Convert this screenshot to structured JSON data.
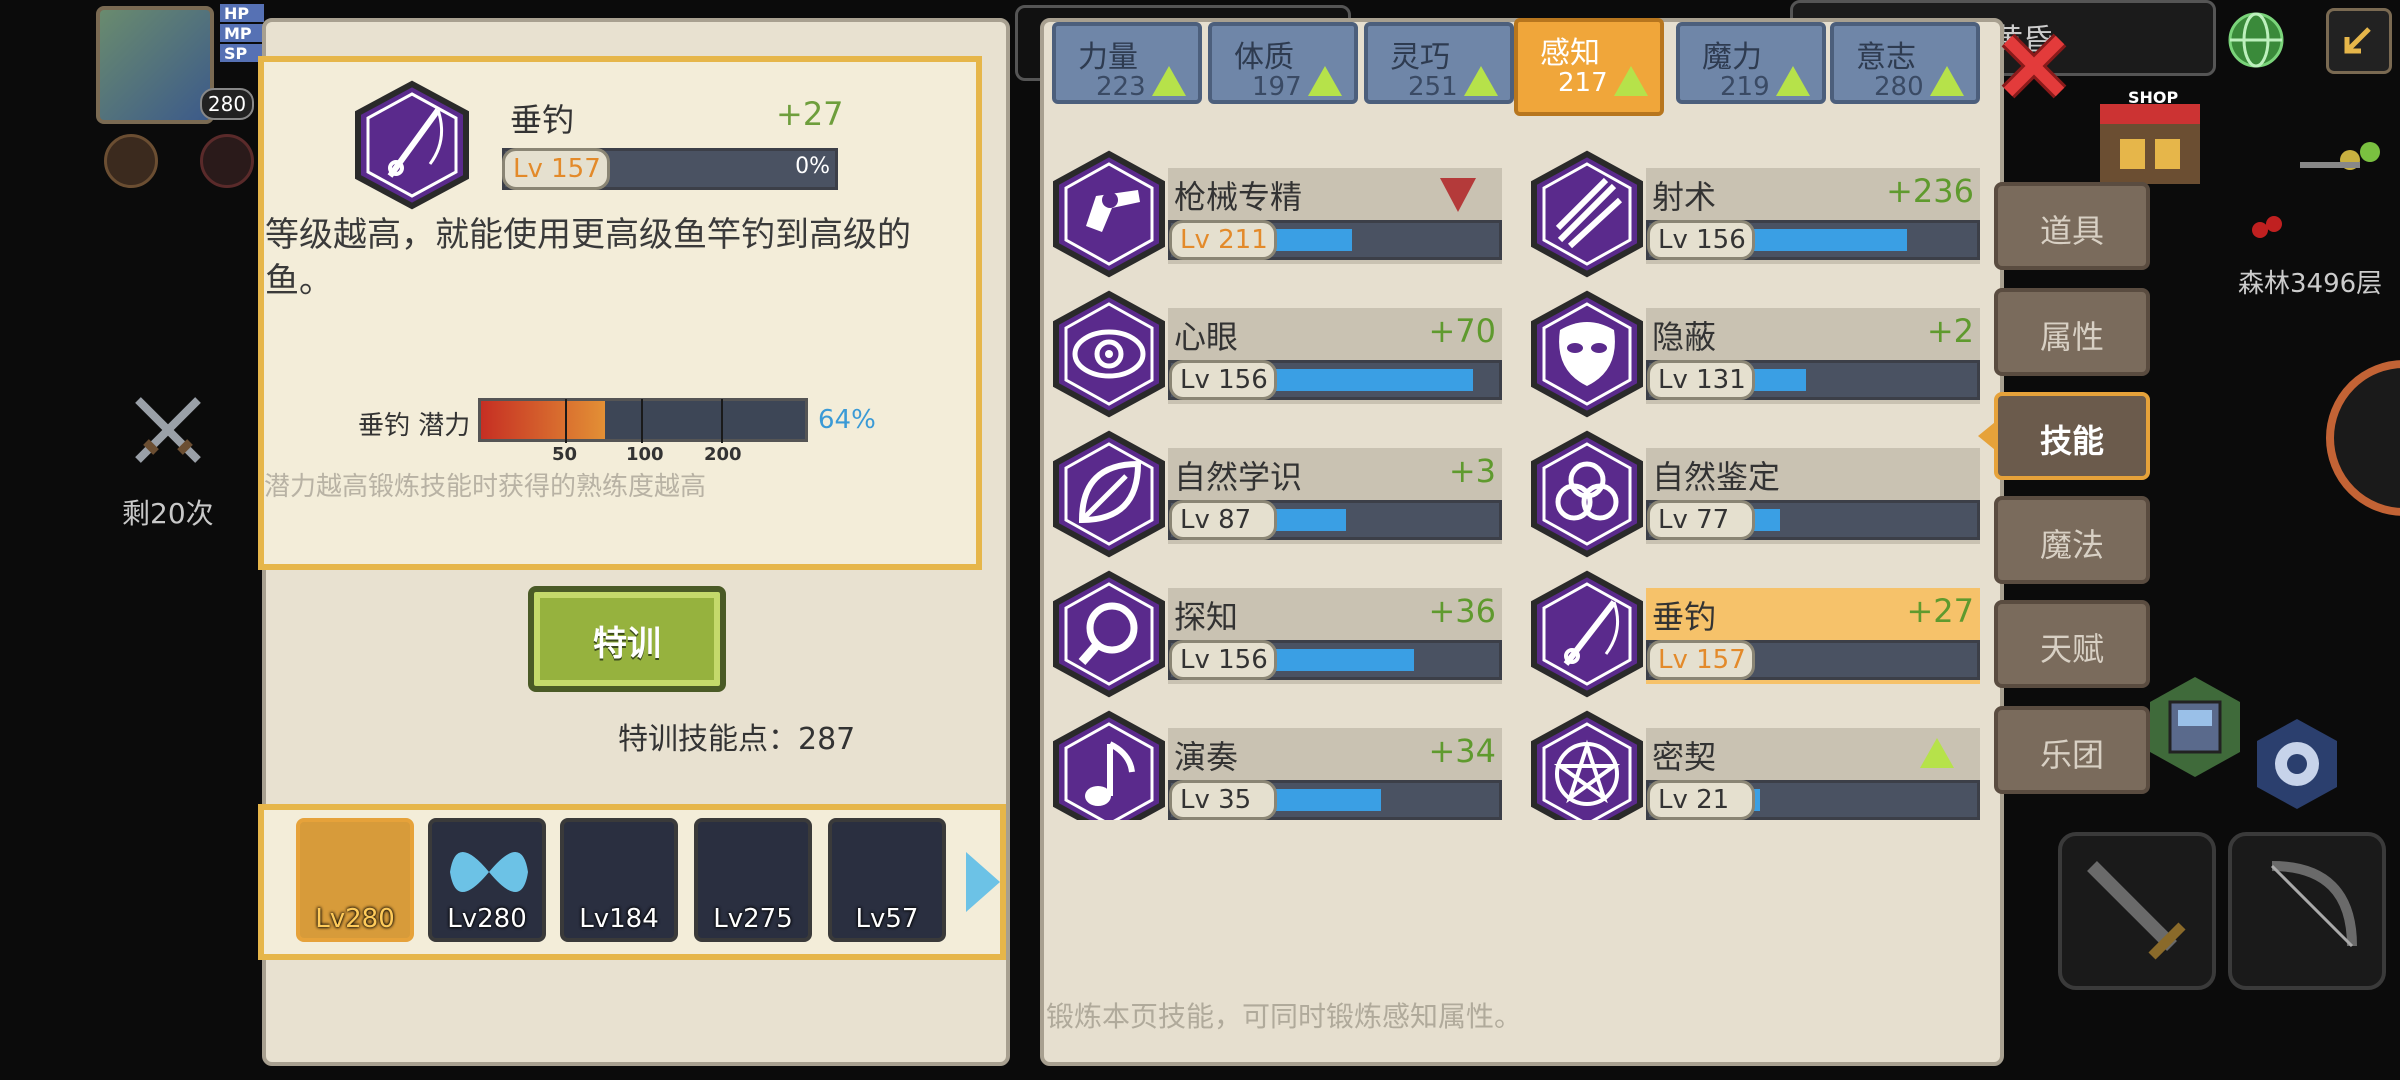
{
  "hud": {
    "hp_label": "HP",
    "mp_label": "MP",
    "sp_label": "SP",
    "player_level": "280",
    "attack_count": "剩20次",
    "floor": "森林3496层",
    "shop_label": "SHOP",
    "location_partial": "黄昏"
  },
  "stat_tabs": [
    {
      "name": "力量",
      "value": "223"
    },
    {
      "name": "体质",
      "value": "197"
    },
    {
      "name": "灵巧",
      "value": "251"
    },
    {
      "name": "感知",
      "value": "217"
    },
    {
      "name": "魔力",
      "value": "219"
    },
    {
      "name": "意志",
      "value": "280"
    }
  ],
  "detail": {
    "title": "垂钓",
    "bonus": "+27",
    "level": "Lv 157",
    "progress_text": "0%",
    "progress": 0,
    "description": "等级越高，就能使用更高级鱼竿钓到高级的鱼。",
    "potential_label": "垂钓 潜力",
    "potential_pct": "64%",
    "potential_value": 0.64,
    "potential_ticks": [
      "50",
      "100",
      "200"
    ],
    "hint": "潜力越高锻炼技能时获得的熟练度越高"
  },
  "train": {
    "button_label": "特训",
    "points_text": "特训技能点：",
    "points_value": "287"
  },
  "portraits": [
    {
      "level": "Lv280",
      "selected": true
    },
    {
      "level": "Lv280",
      "selected": false
    },
    {
      "level": "Lv184",
      "selected": false
    },
    {
      "level": "Lv275",
      "selected": false
    },
    {
      "level": "Lv57",
      "selected": false
    }
  ],
  "skills": [
    {
      "name": "枪械专精",
      "bonus": "",
      "level": "Lv 211",
      "progress": 0.37,
      "icon": "revolver-icon",
      "orange_level": true,
      "indicator": "down"
    },
    {
      "name": "射术",
      "bonus": "+236",
      "level": "Lv 156",
      "progress": 0.72,
      "icon": "arrows-icon",
      "orange_level": false,
      "indicator": ""
    },
    {
      "name": "心眼",
      "bonus": "+70",
      "level": "Lv 156",
      "progress": 0.92,
      "icon": "spiral-eye-icon",
      "orange_level": false,
      "indicator": ""
    },
    {
      "name": "隐蔽",
      "bonus": "+2",
      "level": "Lv 131",
      "progress": 0.26,
      "icon": "mask-icon",
      "orange_level": false,
      "indicator": ""
    },
    {
      "name": "自然学识",
      "bonus": "+3",
      "level": "Lv 87",
      "progress": 0.34,
      "icon": "leaf-icon",
      "orange_level": false,
      "indicator": ""
    },
    {
      "name": "自然鉴定",
      "bonus": "",
      "level": "Lv 77",
      "progress": 0.14,
      "icon": "triquetra-icon",
      "orange_level": false,
      "indicator": ""
    },
    {
      "name": "探知",
      "bonus": "+36",
      "level": "Lv 156",
      "progress": 0.65,
      "icon": "magnifier-icon",
      "orange_level": false,
      "indicator": ""
    },
    {
      "name": "垂钓",
      "bonus": "+27",
      "level": "Lv 157",
      "progress": 0.0,
      "icon": "fishing-rod-icon",
      "orange_level": true,
      "indicator": "",
      "highlight": true
    },
    {
      "name": "演奏",
      "bonus": "+34",
      "level": "Lv 35",
      "progress": 0.5,
      "icon": "music-note-icon",
      "orange_level": false,
      "indicator": ""
    },
    {
      "name": "密契",
      "bonus": "",
      "level": "Lv 21",
      "progress": 0.05,
      "icon": "pentagram-icon",
      "orange_level": false,
      "indicator": "up"
    }
  ],
  "footer_hint": "锻炼本页技能，可同时锻炼感知属性。",
  "menu": [
    {
      "label": "道具",
      "active": false
    },
    {
      "label": "属性",
      "active": false
    },
    {
      "label": "技能",
      "active": true
    },
    {
      "label": "魔法",
      "active": false
    },
    {
      "label": "天赋",
      "active": false
    },
    {
      "label": "乐团",
      "active": false
    }
  ],
  "colors": {
    "accent_gold": "#e6b64a",
    "tab_active": "#f0a63a",
    "skill_purple": "#5a2a8c",
    "progress_blue": "#3a9fe4",
    "bonus_green": "#5f9a2e"
  }
}
